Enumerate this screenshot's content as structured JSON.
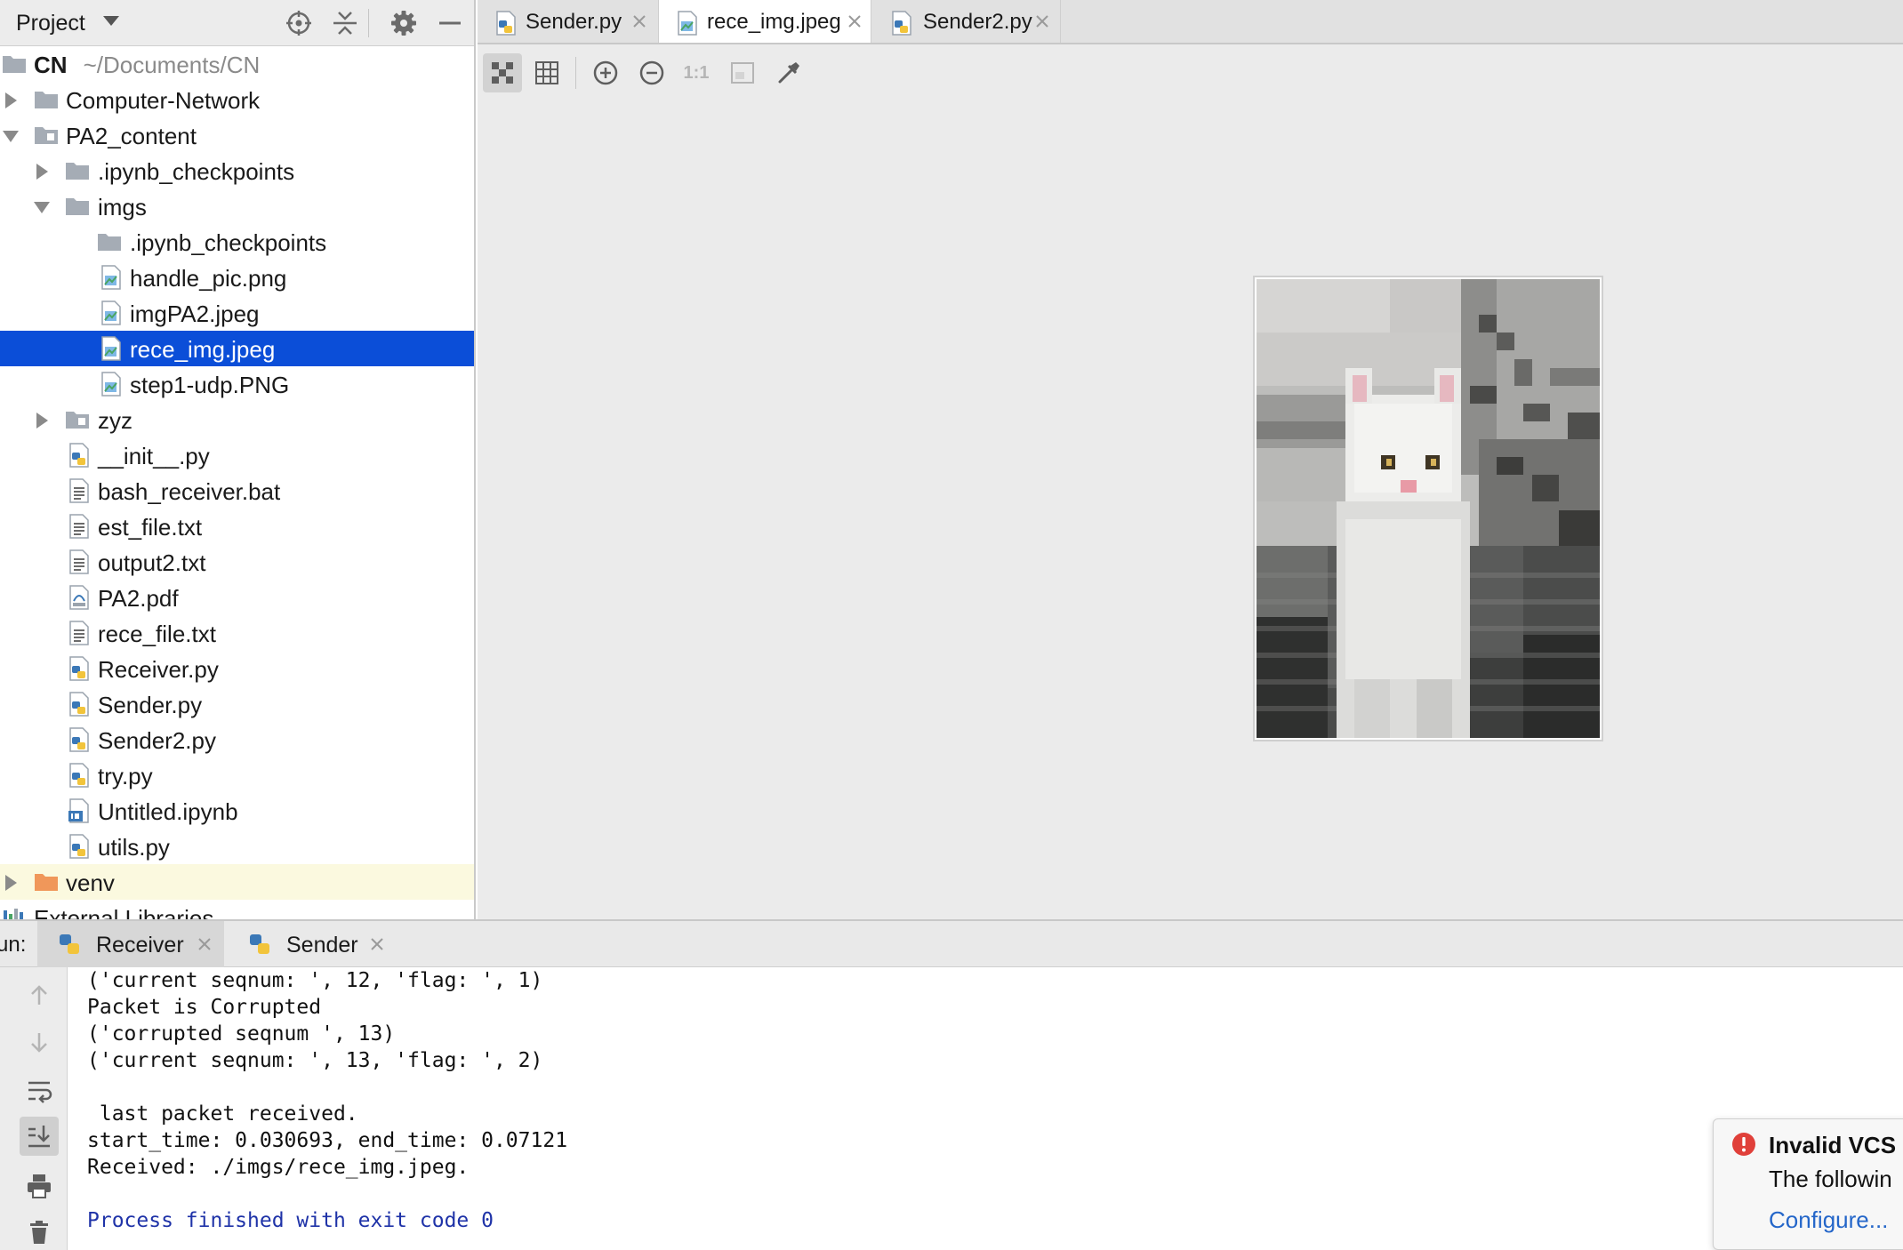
{
  "project_panel": {
    "title": "Project",
    "header_icons": [
      "locate-icon",
      "collapse-all-icon",
      "gear-icon",
      "minimize-icon"
    ]
  },
  "tree": {
    "root": {
      "name": "CN",
      "path": "~/Documents/CN"
    },
    "items": [
      {
        "label": "Computer-Network",
        "kind": "folder"
      },
      {
        "label": "PA2_content",
        "kind": "folder"
      },
      {
        "label": ".ipynb_checkpoints",
        "kind": "folder"
      },
      {
        "label": "imgs",
        "kind": "folder"
      },
      {
        "label": ".ipynb_checkpoints",
        "kind": "folder"
      },
      {
        "label": "handle_pic.png",
        "kind": "image"
      },
      {
        "label": "imgPA2.jpeg",
        "kind": "image"
      },
      {
        "label": "rece_img.jpeg",
        "kind": "image"
      },
      {
        "label": "step1-udp.PNG",
        "kind": "image"
      },
      {
        "label": "zyz",
        "kind": "folder"
      },
      {
        "label": "__init__.py",
        "kind": "python"
      },
      {
        "label": "bash_receiver.bat",
        "kind": "text"
      },
      {
        "label": "est_file.txt",
        "kind": "text"
      },
      {
        "label": "output2.txt",
        "kind": "text"
      },
      {
        "label": "PA2.pdf",
        "kind": "pdf"
      },
      {
        "label": "rece_file.txt",
        "kind": "text"
      },
      {
        "label": "Receiver.py",
        "kind": "python"
      },
      {
        "label": "Sender.py",
        "kind": "python"
      },
      {
        "label": "Sender2.py",
        "kind": "python"
      },
      {
        "label": "try.py",
        "kind": "python"
      },
      {
        "label": "Untitled.ipynb",
        "kind": "notebook"
      },
      {
        "label": "utils.py",
        "kind": "python"
      },
      {
        "label": "venv",
        "kind": "folder"
      },
      {
        "label": "External Libraries",
        "kind": "library"
      }
    ]
  },
  "editor": {
    "tabs": [
      {
        "label": "Sender.py",
        "active": false
      },
      {
        "label": "rece_img.jpeg",
        "active": true
      },
      {
        "label": "Sender2.py",
        "active": false
      }
    ],
    "toolbar": {
      "actual_size_label": "1:1"
    }
  },
  "run": {
    "prefix": "un:",
    "tabs": [
      {
        "label": "Receiver",
        "active": true
      },
      {
        "label": "Sender",
        "active": false
      }
    ],
    "console_lines": [
      "('current seqnum: ', 12, 'flag: ', 1)",
      "Packet is Corrupted",
      "('corrupted seqnum ', 13)",
      "('current seqnum: ', 13, 'flag: ', 2)",
      "",
      " last packet received.",
      "start_time: 0.030693, end_time: 0.07121",
      "Received: ./imgs/rece_img.jpeg.",
      "",
      "Process finished with exit code 0"
    ]
  },
  "notification": {
    "title": "Invalid VCS",
    "body": "The followin",
    "link": "Configure..."
  },
  "colors": {
    "selection": "#0b4ed8",
    "link": "#2466c9",
    "exit_text": "#1f33a8",
    "folder": "#a5acb5",
    "excluded_folder": "#f0975a",
    "error": "#e0403a"
  }
}
